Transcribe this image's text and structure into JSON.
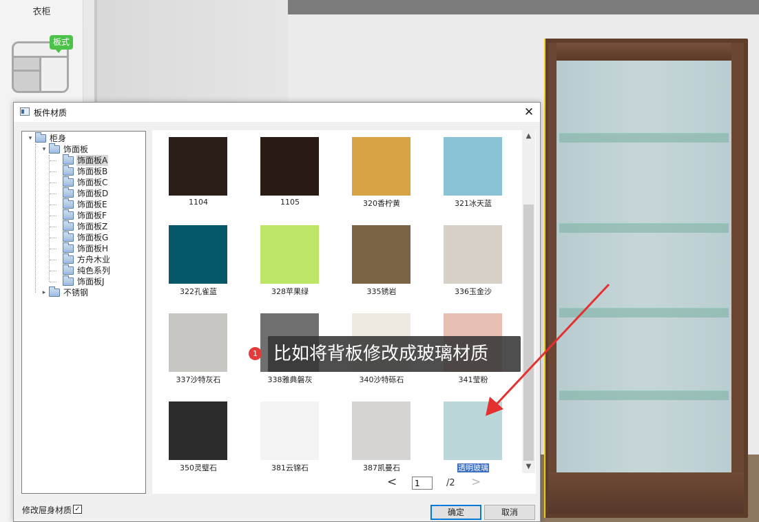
{
  "left_panel": {
    "title": "衣柜",
    "badge": "板式"
  },
  "dialog": {
    "title": "板件材质",
    "close": "✕",
    "tree": [
      {
        "label": "柜身",
        "toggle": "▾"
      },
      {
        "label": "饰面板",
        "toggle": "▾"
      },
      {
        "label": "饰面板A"
      },
      {
        "label": "饰面板B"
      },
      {
        "label": "饰面板C"
      },
      {
        "label": "饰面板D"
      },
      {
        "label": "饰面板E"
      },
      {
        "label": "饰面板F"
      },
      {
        "label": "饰面板Z"
      },
      {
        "label": "饰面板G"
      },
      {
        "label": "饰面板H"
      },
      {
        "label": "方舟木业"
      },
      {
        "label": "纯色系列"
      },
      {
        "label": "饰面板J"
      },
      {
        "label": "不锈钢",
        "toggle": "▸"
      }
    ],
    "materials": [
      {
        "name": "1104",
        "color": "#2b1d17"
      },
      {
        "name": "1105",
        "color": "#2a1a14"
      },
      {
        "name": "320香柠黄",
        "color": "#d8a345"
      },
      {
        "name": "321冰天蓝",
        "color": "#8ac3d6"
      },
      {
        "name": "322孔雀蓝",
        "color": "#055769"
      },
      {
        "name": "328苹果绿",
        "color": "#bde566"
      },
      {
        "name": "335锈岩",
        "color": "#7b6446"
      },
      {
        "name": "336玉金沙",
        "color": "#d6d0c6"
      },
      {
        "name": "337沙特灰石",
        "color": "#c8c6c2"
      },
      {
        "name": "338雅典磐灰",
        "color": "#6f6f6f"
      },
      {
        "name": "340沙特砾石",
        "color": "#eeeae0"
      },
      {
        "name": "341莹粉",
        "color": "#e8bfb3"
      },
      {
        "name": "350灵璧石",
        "color": "#2c2c2c"
      },
      {
        "name": "381云锦石",
        "color": "#f4f4f4"
      },
      {
        "name": "387凯曼石",
        "color": "#d5d4d2"
      },
      {
        "name": "透明玻璃",
        "color": "#bcd7d9"
      }
    ],
    "pager": {
      "prev": "<",
      "page": "1",
      "total": "/2",
      "next": ">"
    },
    "modify_label": "修改屉身材质",
    "modify_checked": "✓",
    "ok": "确定",
    "cancel": "取消"
  },
  "annotation": {
    "number": "1",
    "text": "比如将背板修改成玻璃材质"
  }
}
